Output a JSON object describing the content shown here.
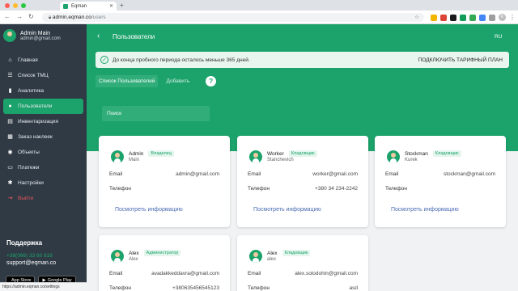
{
  "browser": {
    "tab_title": "Eqman",
    "url_host": "admin.eqman.co",
    "url_path": "/users",
    "extension_colors": [
      "#f4b400",
      "#db4437",
      "#1a1a1a",
      "#0f9d58",
      "#34a853",
      "#4285f4",
      "#9e9e9e"
    ],
    "avatar_letter": "K"
  },
  "sidebar": {
    "user_name": "Admin Main",
    "user_email": "admin@gmail.com",
    "items": [
      {
        "label": "Главная",
        "icon": "home-icon",
        "glyph": "⌂"
      },
      {
        "label": "Список ТМЦ",
        "icon": "list-icon",
        "glyph": "☰"
      },
      {
        "label": "Аналитика",
        "icon": "analytics-icon",
        "glyph": "▮"
      },
      {
        "label": "Пользователи",
        "icon": "users-icon",
        "glyph": "●"
      },
      {
        "label": "Инвентаризация",
        "icon": "inventory-icon",
        "glyph": "▤"
      },
      {
        "label": "Заказ наклеек",
        "icon": "qr-icon",
        "glyph": "▦"
      },
      {
        "label": "Объекты",
        "icon": "location-icon",
        "glyph": "◉"
      },
      {
        "label": "Платежи",
        "icon": "payments-icon",
        "glyph": "▭"
      },
      {
        "label": "Настройки",
        "icon": "gear-icon",
        "glyph": "✱"
      },
      {
        "label": "Выйти",
        "icon": "logout-icon",
        "glyph": "⇥"
      }
    ],
    "active_index": 3,
    "support_title": "Поддержка",
    "support_phone": "+38(066) 33 60 616",
    "support_email": "support@eqman.co",
    "app_store": "App Store",
    "google_play": "Google Play",
    "status_url": "https://admin.eqman.co/settings"
  },
  "header": {
    "title": "Пользователи",
    "lang": "RU"
  },
  "trial": {
    "message": "До конца пробного периода осталось меньше 365 дней.",
    "action": "ПОДКЛЮЧИТЬ ТАРИФНЫЙ ПЛАН"
  },
  "tabs": {
    "list": "Список Пользователей",
    "add": "Добавить",
    "help": "?"
  },
  "search": {
    "placeholder": "Поиск"
  },
  "labels": {
    "email": "Email",
    "phone": "Телефон",
    "more": "Посмотреть информацию"
  },
  "users": [
    {
      "name": "Admin",
      "role": "Владелец",
      "sub": "Main",
      "email": "admin@gmail.com",
      "phone": ""
    },
    {
      "name": "Worker",
      "role": "Кладовщик",
      "sub": "Stanchevich",
      "email": "worker@gmail.com",
      "phone": "+380 34 234-2242"
    },
    {
      "name": "Stockman",
      "role": "Кладовщик",
      "sub": "Kurek",
      "email": "stockman@gmail.com",
      "phone": ""
    },
    {
      "name": "Alex",
      "role": "Администратор",
      "sub": "Alex",
      "email": "avadakkeddavra@gmail.com",
      "phone": "+380635456545123"
    },
    {
      "name": "Alex",
      "role": "Кладовщик",
      "sub": "alex",
      "email": "alex.solodohin@gmail.com",
      "phone": "asd"
    }
  ]
}
